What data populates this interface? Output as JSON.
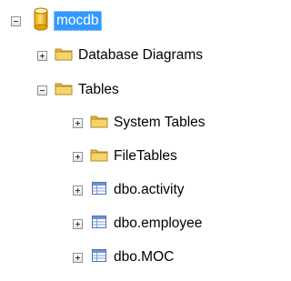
{
  "tree": {
    "database": {
      "label": "mocdb",
      "icon": "database-icon",
      "expanded": true,
      "selected": true
    },
    "children": [
      {
        "label": "Database Diagrams",
        "icon": "folder-icon",
        "expanded": false
      },
      {
        "label": "Tables",
        "icon": "folder-icon",
        "expanded": true
      }
    ],
    "tables": [
      {
        "label": "System Tables",
        "icon": "folder-icon",
        "expanded": false
      },
      {
        "label": "FileTables",
        "icon": "folder-icon",
        "expanded": false
      },
      {
        "label": "dbo.activity",
        "icon": "table-icon",
        "expanded": false
      },
      {
        "label": "dbo.employee",
        "icon": "table-icon",
        "expanded": false
      },
      {
        "label": "dbo.MOC",
        "icon": "table-icon",
        "expanded": false
      }
    ]
  },
  "colors": {
    "selection": "#3399ff",
    "folder": "#f2c14e",
    "database": "#f5b400",
    "table_icon": "#4a73b5"
  }
}
